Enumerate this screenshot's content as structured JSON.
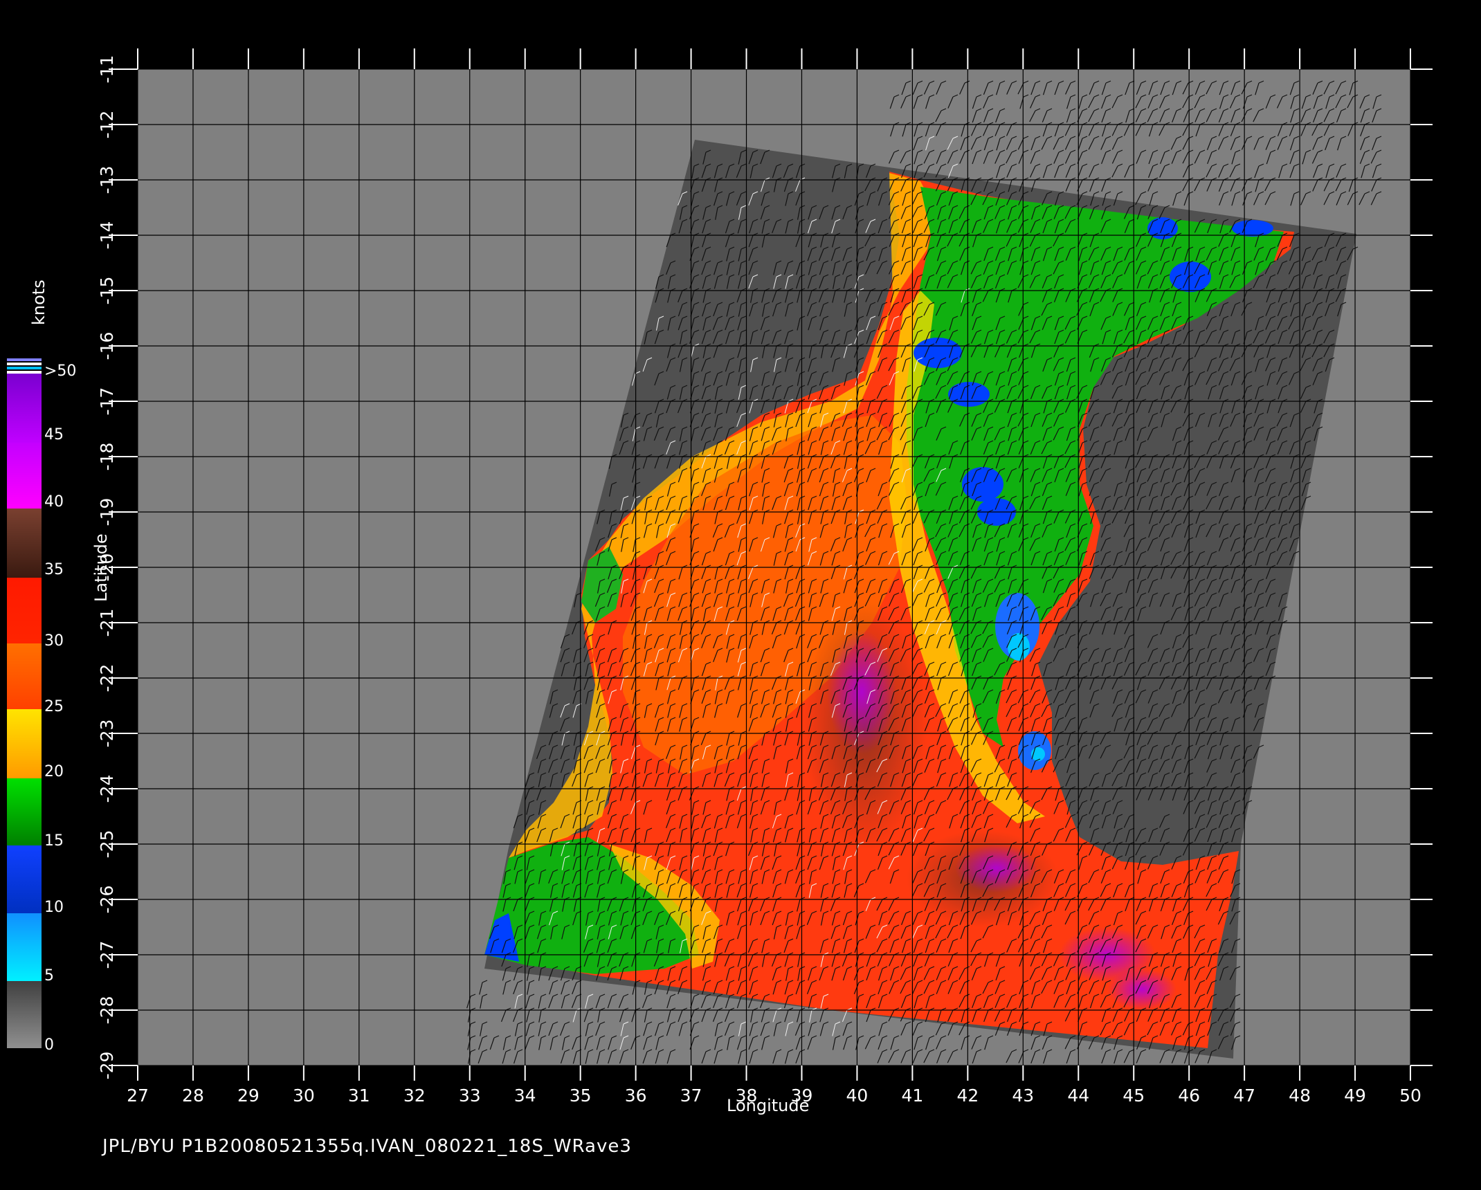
{
  "footer": "JPL/BYU  P1B20080521355q.IVAN_080221_18S_WRave3",
  "axes": {
    "xlabel": "Longitude",
    "ylabel": "Latitude",
    "lon_range": [
      27,
      50
    ],
    "lat_range": [
      -29,
      -11
    ],
    "lon_ticks": [
      "27",
      "28",
      "29",
      "30",
      "31",
      "32",
      "33",
      "34",
      "35",
      "36",
      "37",
      "38",
      "39",
      "40",
      "41",
      "42",
      "43",
      "44",
      "45",
      "46",
      "47",
      "48",
      "49",
      "50"
    ],
    "lat_ticks": [
      "-11",
      "-12",
      "-13",
      "-14",
      "-15",
      "-16",
      "-17",
      "-18",
      "-19",
      "-20",
      "-21",
      "-22",
      "-23",
      "-24",
      "-25",
      "-26",
      "-27",
      "-28",
      "-29"
    ],
    "grid": true
  },
  "colorbar": {
    "units": "knots",
    "labels": [
      ">50",
      "45",
      "40",
      "35",
      "30",
      "25",
      "20",
      "15",
      "10",
      "5",
      "0"
    ],
    "colors": {
      "0-5": "#6e6e6e",
      "5-10": "#00e5ff",
      "10-15": "#0050ff",
      "15-20": "#00b400",
      "20-25": "#ffd200",
      "25-30": "#ff5a00",
      "30-35": "#ff2000",
      "35-40": "#6a2a18",
      "40-45": "#ff00ff",
      ">50": "#7a00d0"
    }
  },
  "colors": {
    "background": "#000000",
    "map_gray": "#808080",
    "swath_dark": "#505050",
    "grid": "#000000"
  }
}
